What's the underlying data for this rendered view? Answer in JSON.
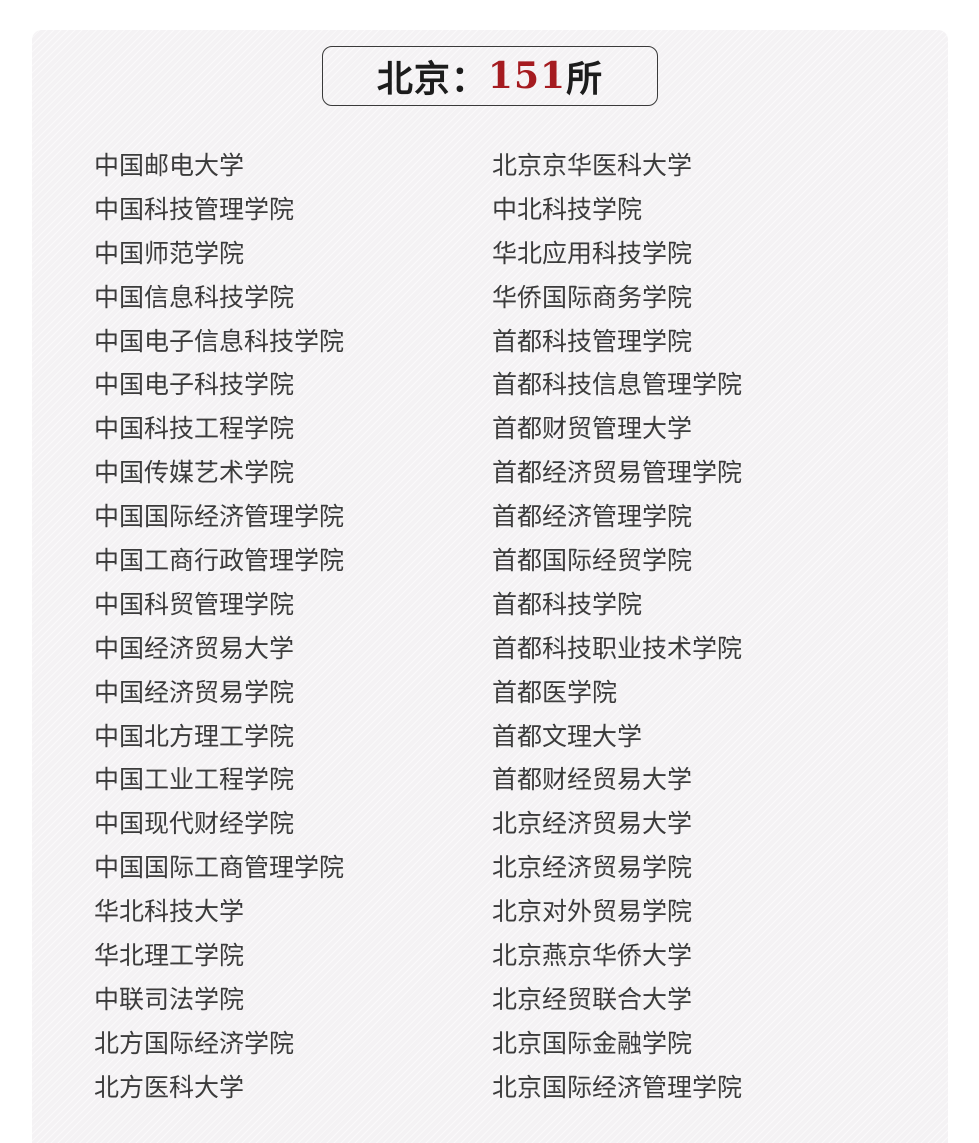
{
  "header": {
    "region": "北京：",
    "count": "151",
    "unit": "所"
  },
  "left_column": [
    "中国邮电大学",
    "中国科技管理学院",
    "中国师范学院",
    "中国信息科技学院",
    "中国电子信息科技学院",
    "中国电子科技学院",
    "中国科技工程学院",
    "中国传媒艺术学院",
    "中国国际经济管理学院",
    "中国工商行政管理学院",
    "中国科贸管理学院",
    "中国经济贸易大学",
    "中国经济贸易学院",
    "中国北方理工学院",
    "中国工业工程学院",
    "中国现代财经学院",
    "中国国际工商管理学院",
    "华北科技大学",
    "华北理工学院",
    "中联司法学院",
    "北方国际经济学院",
    "北方医科大学"
  ],
  "right_column": [
    "北京京华医科大学",
    "中北科技学院",
    "华北应用科技学院",
    "华侨国际商务学院",
    "首都科技管理学院",
    "首都科技信息管理学院",
    "首都财贸管理大学",
    "首都经济贸易管理学院",
    "首都经济管理学院",
    "首都国际经贸学院",
    "首都科技学院",
    "首都科技职业技术学院",
    "首都医学院",
    "首都文理大学",
    "首都财经贸易大学",
    "北京经济贸易大学",
    "北京经济贸易学院",
    "北京对外贸易学院",
    "北京燕京华侨大学",
    "北京经贸联合大学",
    "北京国际金融学院",
    "北京国际经济管理学院"
  ],
  "colors": {
    "count_accent": "#a51b20",
    "text": "#3b3b3b",
    "card_background": "#f4f2f4"
  }
}
